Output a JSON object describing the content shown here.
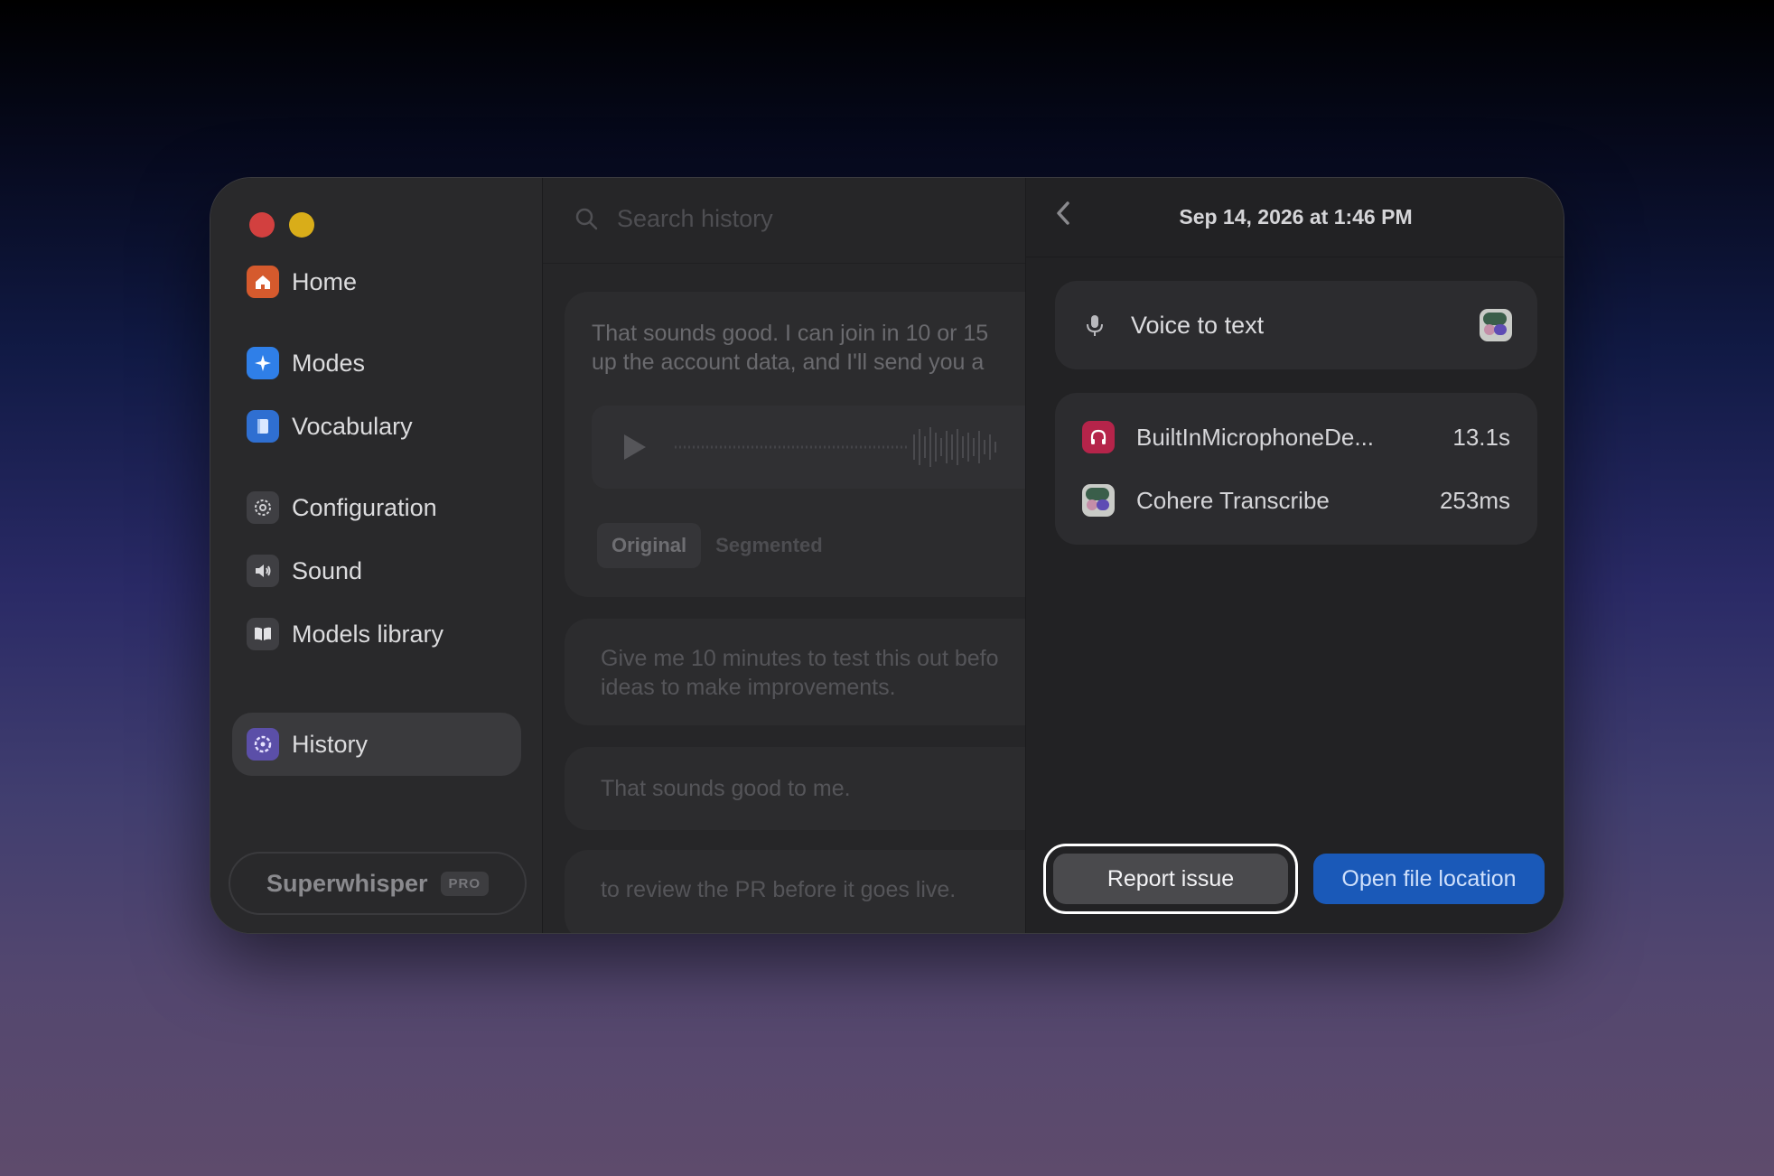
{
  "sidebar": {
    "items": [
      {
        "label": "Home",
        "icon": "home-icon"
      },
      {
        "label": "Modes",
        "icon": "sparkle-icon"
      },
      {
        "label": "Vocabulary",
        "icon": "book-icon"
      },
      {
        "label": "Configuration",
        "icon": "gear-icon"
      },
      {
        "label": "Sound",
        "icon": "speaker-icon"
      },
      {
        "label": "Models library",
        "icon": "open-book-icon"
      },
      {
        "label": "History",
        "icon": "history-icon"
      }
    ],
    "active": "History",
    "footer": {
      "name": "Superwhisper",
      "badge": "PRO"
    }
  },
  "search": {
    "placeholder": "Search history"
  },
  "history": {
    "selected": {
      "text_line1": "That sounds good. I can join in 10 or 15",
      "text_line2": "up the account data, and I'll send you a",
      "tabs": [
        "Original",
        "Segmented"
      ],
      "active_tab": "Original"
    },
    "items": [
      {
        "line1": "Give me 10 minutes to test this out befo",
        "line2": "ideas to make improvements."
      },
      {
        "line1": "That sounds good to me."
      },
      {
        "line1": "to review the PR before it goes live."
      }
    ]
  },
  "detail": {
    "date": "Sep 14, 2026 at 1:46 PM",
    "mode": {
      "label": "Voice to text",
      "icon": "microphone-icon",
      "model_icon": "cohere-icon"
    },
    "stats": [
      {
        "name": "BuiltInMicrophoneDe...",
        "value": "13.1s",
        "icon": "headphones-icon"
      },
      {
        "name": "Cohere Transcribe",
        "value": "253ms",
        "icon": "cohere-icon"
      }
    ],
    "buttons": {
      "report": "Report issue",
      "open": "Open file location"
    }
  },
  "colors": {
    "accent": "#1a59b8",
    "close": "#d2403f",
    "minimize": "#d9ad19"
  }
}
